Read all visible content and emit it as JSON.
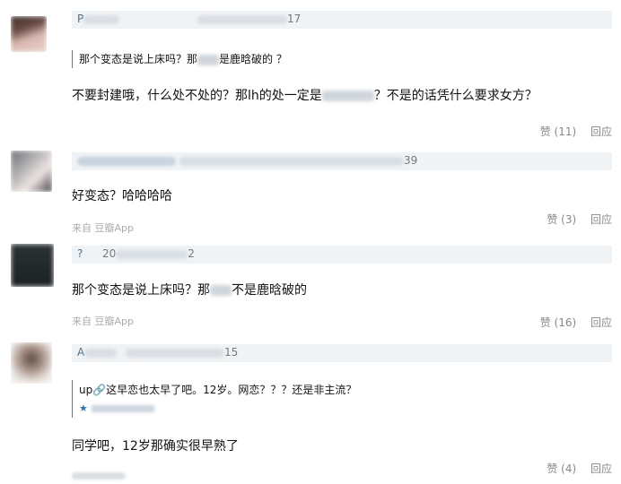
{
  "comments": [
    {
      "user_prefix": "P",
      "date_tail": "17",
      "quote": "那个变态是说上床吗？那",
      "quote_tail": "是鹿晗破的 ？",
      "text_a": "不要封建哦，什么处不处的？那lh的处一定是",
      "text_b": "？不是的话凭什么要求女方？",
      "likes": "赞 (11)",
      "reply": "回应"
    },
    {
      "user_prefix": "",
      "date_tail": "39",
      "text": "好变态？哈哈哈哈",
      "source": "来自 豆瓣App",
      "likes": "赞 (3)",
      "reply": "回应"
    },
    {
      "user_prefix": "?",
      "date_head": "20",
      "date_tail": "2",
      "text_a": "那个变态是说上床吗？那",
      "text_b": "不是鹿晗破的",
      "source": "来自 豆瓣App",
      "likes": "赞 (16)",
      "reply": "回应"
    },
    {
      "user_prefix": "A",
      "date_tail": "15",
      "quote": "up🔗这早恋也太早了吧。12岁。网恋？？？还是非主流？",
      "text": "同学吧，12岁那确实很早熟了",
      "likes": "赞 (4)",
      "reply": "回应"
    }
  ]
}
